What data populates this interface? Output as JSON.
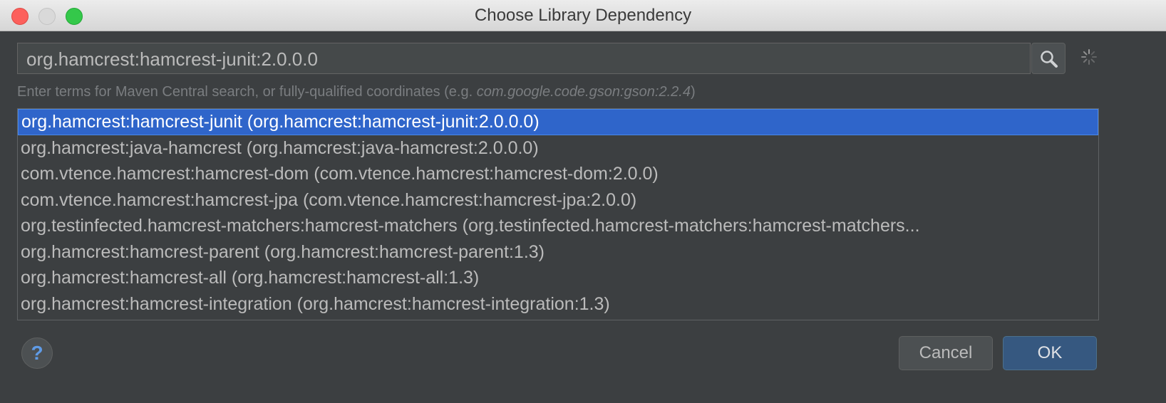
{
  "window": {
    "title": "Choose Library Dependency"
  },
  "search": {
    "value": "org.hamcrest:hamcrest-junit:2.0.0.0",
    "hint_prefix": "Enter terms for Maven Central search, or fully-qualified coordinates (e.g. ",
    "hint_example": "com.google.code.gson:gson:2.2.4",
    "hint_suffix": ")"
  },
  "results": [
    "org.hamcrest:hamcrest-junit (org.hamcrest:hamcrest-junit:2.0.0.0)",
    "org.hamcrest:java-hamcrest (org.hamcrest:java-hamcrest:2.0.0.0)",
    "com.vtence.hamcrest:hamcrest-dom (com.vtence.hamcrest:hamcrest-dom:2.0.0)",
    "com.vtence.hamcrest:hamcrest-jpa (com.vtence.hamcrest:hamcrest-jpa:2.0.0)",
    "org.testinfected.hamcrest-matchers:hamcrest-matchers (org.testinfected.hamcrest-matchers:hamcrest-matchers...",
    "org.hamcrest:hamcrest-parent (org.hamcrest:hamcrest-parent:1.3)",
    "org.hamcrest:hamcrest-all (org.hamcrest:hamcrest-all:1.3)",
    "org.hamcrest:hamcrest-integration (org.hamcrest:hamcrest-integration:1.3)"
  ],
  "selected_index": 0,
  "buttons": {
    "help": "?",
    "cancel": "Cancel",
    "ok": "OK"
  },
  "icons": {
    "close": "close-traffic-light",
    "minimize": "minimize-traffic-light",
    "maximize": "maximize-traffic-light",
    "search": "search-icon",
    "loading": "loading-spinner-icon",
    "help": "help-icon"
  },
  "colors": {
    "selection": "#2f65ca",
    "ok_button": "#365880",
    "background": "#3c3f41"
  }
}
